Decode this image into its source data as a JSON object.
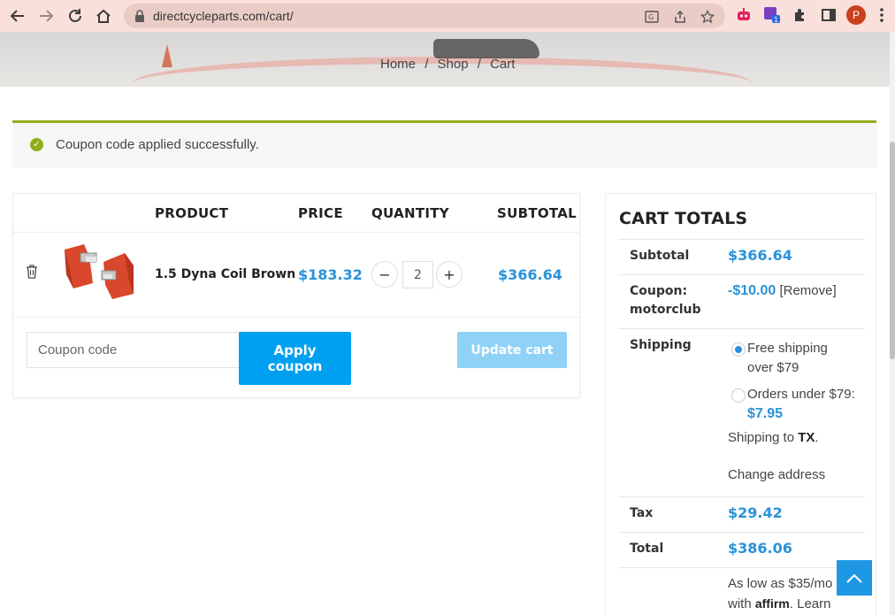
{
  "browser": {
    "url": "directcycleparts.com/cart/",
    "profile_initial": "P",
    "extension_badge": "1"
  },
  "breadcrumb": [
    "Home",
    "/",
    "Shop",
    "/",
    "Cart"
  ],
  "notice": {
    "message": "Coupon code applied successfully.",
    "color": "#8fae1b"
  },
  "cart": {
    "headers": {
      "product": "PRODUCT",
      "price": "PRICE",
      "quantity": "QUANTITY",
      "subtotal": "SUBTOTAL"
    },
    "items": [
      {
        "name": "1.5 Dyna Coil Brown",
        "price": "$183.32",
        "quantity": "2",
        "subtotal": "$366.64"
      }
    ],
    "qty_minus": "−",
    "qty_plus": "+",
    "coupon_placeholder": "Coupon code",
    "apply_label": "Apply coupon",
    "update_label": "Update cart"
  },
  "totals": {
    "title": "CART TOTALS",
    "subtotal_label": "Subtotal",
    "subtotal_value": "$366.64",
    "coupon_label": "Coupon: motorclub",
    "coupon_value": "-$10.00",
    "coupon_remove": "[Remove]",
    "shipping_label": "Shipping",
    "shipping_option1": "Free shipping over $79",
    "shipping_option2_text": "Orders under $79:",
    "shipping_option2_price": "$7.95",
    "shipping_to_text": "Shipping to",
    "shipping_to_state": "TX",
    "change_address": "Change address",
    "tax_label": "Tax",
    "tax_value": "$29.42",
    "total_label": "Total",
    "total_value": "$386.06",
    "affirm_line1": "As low as $35/mo",
    "affirm_with": "with",
    "affirm_brand": "affirm",
    "affirm_learn": ". Learn"
  },
  "colors": {
    "accent": "#2a92d8",
    "button": "#00a0f0",
    "button_disabled": "#8fd2f6",
    "chrome_bg": "#f9e0db"
  }
}
